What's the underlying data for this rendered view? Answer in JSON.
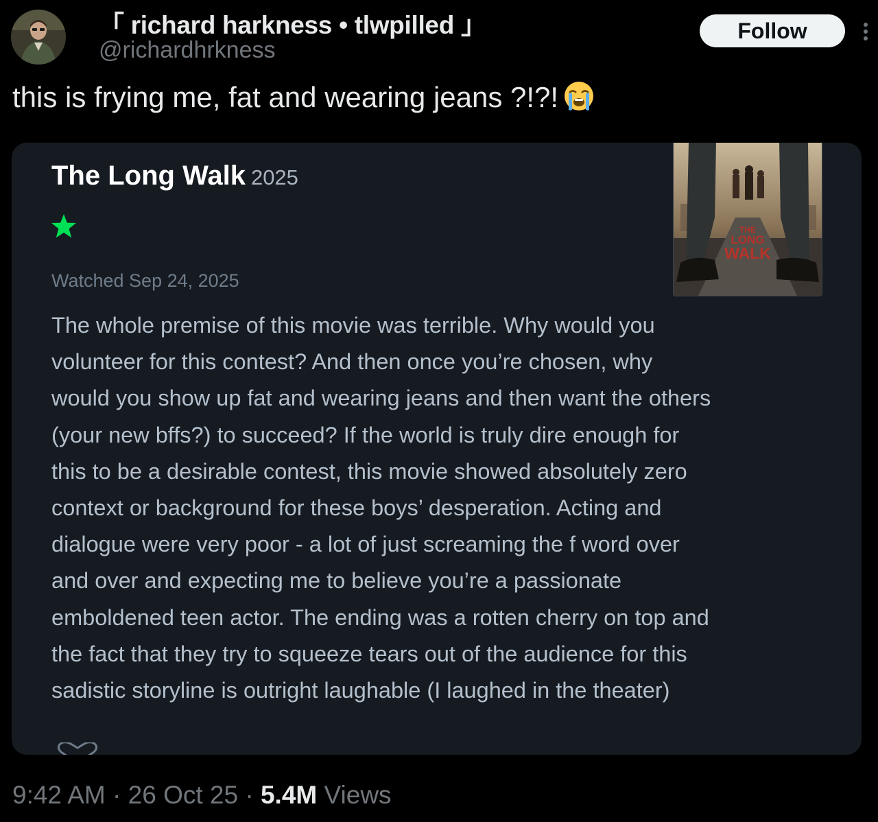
{
  "author": {
    "display_name": "「 richard harkness • tlwpilled 」",
    "handle": "@richardhrkness"
  },
  "follow_label": "Follow",
  "tweet": {
    "text": "this is frying me, fat and wearing jeans ?!?!",
    "emoji": "loudly-crying-face"
  },
  "review_card": {
    "title": "The Long Walk",
    "year": "2025",
    "rating_stars": 1,
    "star_color": "#00e054",
    "watched": "Watched Sep 24, 2025",
    "poster_text": [
      "THE",
      "LONG",
      "WALK"
    ],
    "review_lines": [
      "The whole premise of this movie was terrible. Why would you",
      "volunteer for this contest? And then once you’re chosen, why",
      "would you show up fat and wearing jeans and then want the others",
      "(your new bffs?) to succeed? If the world is truly dire enough for",
      "this to be a desirable contest, this movie showed absolutely zero",
      "context or background for these boys’ desperation. Acting and",
      "dialogue were very poor - a lot of just screaming the f word over",
      "and over and expecting me to believe you’re a passionate",
      "emboldened teen actor. The ending was a rotten cherry on top and",
      "the fact that they try to squeeze tears out of the audience for this",
      "sadistic storyline is outright laughable (I laughed in the theater)"
    ]
  },
  "meta": {
    "time": "9:42 AM",
    "sep": " · ",
    "date": "26 Oct 25",
    "views_count": "5.4M",
    "views_label": " Views"
  },
  "colors": {
    "background": "#000000",
    "card": "#161b21",
    "muted": "#71767b",
    "text": "#e7e9ea"
  }
}
